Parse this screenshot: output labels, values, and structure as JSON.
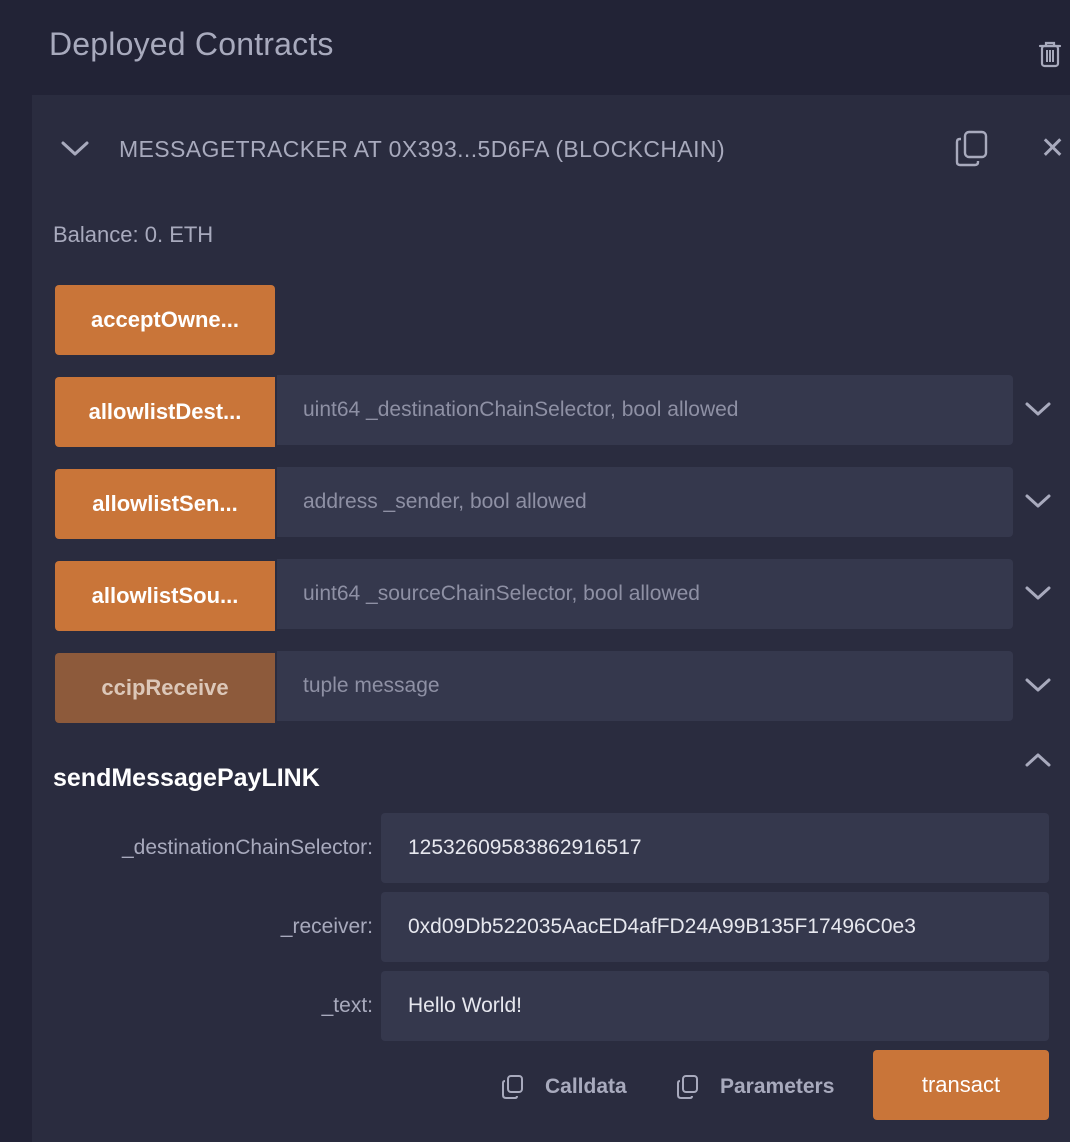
{
  "section": {
    "title": "Deployed Contracts",
    "clear_icon": "trash-icon"
  },
  "contract": {
    "title": "MESSAGETRACKER AT 0X393...5D6FA (BLOCKCHAIN)",
    "balance": "Balance: 0. ETH",
    "icons": {
      "expand": "chevron-down-icon",
      "copy": "copy-icon",
      "close": "close-icon"
    }
  },
  "functions": [
    {
      "label": "acceptOwne...",
      "placeholder": ""
    },
    {
      "label": "allowlistDest...",
      "placeholder": "uint64 _destinationChainSelector, bool allowed"
    },
    {
      "label": "allowlistSen...",
      "placeholder": "address _sender, bool allowed"
    },
    {
      "label": "allowlistSou...",
      "placeholder": "uint64 _sourceChainSelector, bool allowed"
    },
    {
      "label": "ccipReceive",
      "placeholder": "tuple message"
    }
  ],
  "expanded_function": {
    "name": "sendMessagePayLINK",
    "params": [
      {
        "label": "_destinationChainSelector:",
        "value": "12532609583862916517"
      },
      {
        "label": "_receiver:",
        "value": "0xd09Db522035AacED4afFD24A99B135F17496C0e3"
      },
      {
        "label": "_text:",
        "value": "Hello World!"
      }
    ],
    "calldata_label": "Calldata",
    "parameters_label": "Parameters",
    "transact_label": "transact"
  },
  "colors": {
    "accent": "#c97539",
    "background": "#222336",
    "panel": "#2a2c3f",
    "input": "#35384d"
  }
}
